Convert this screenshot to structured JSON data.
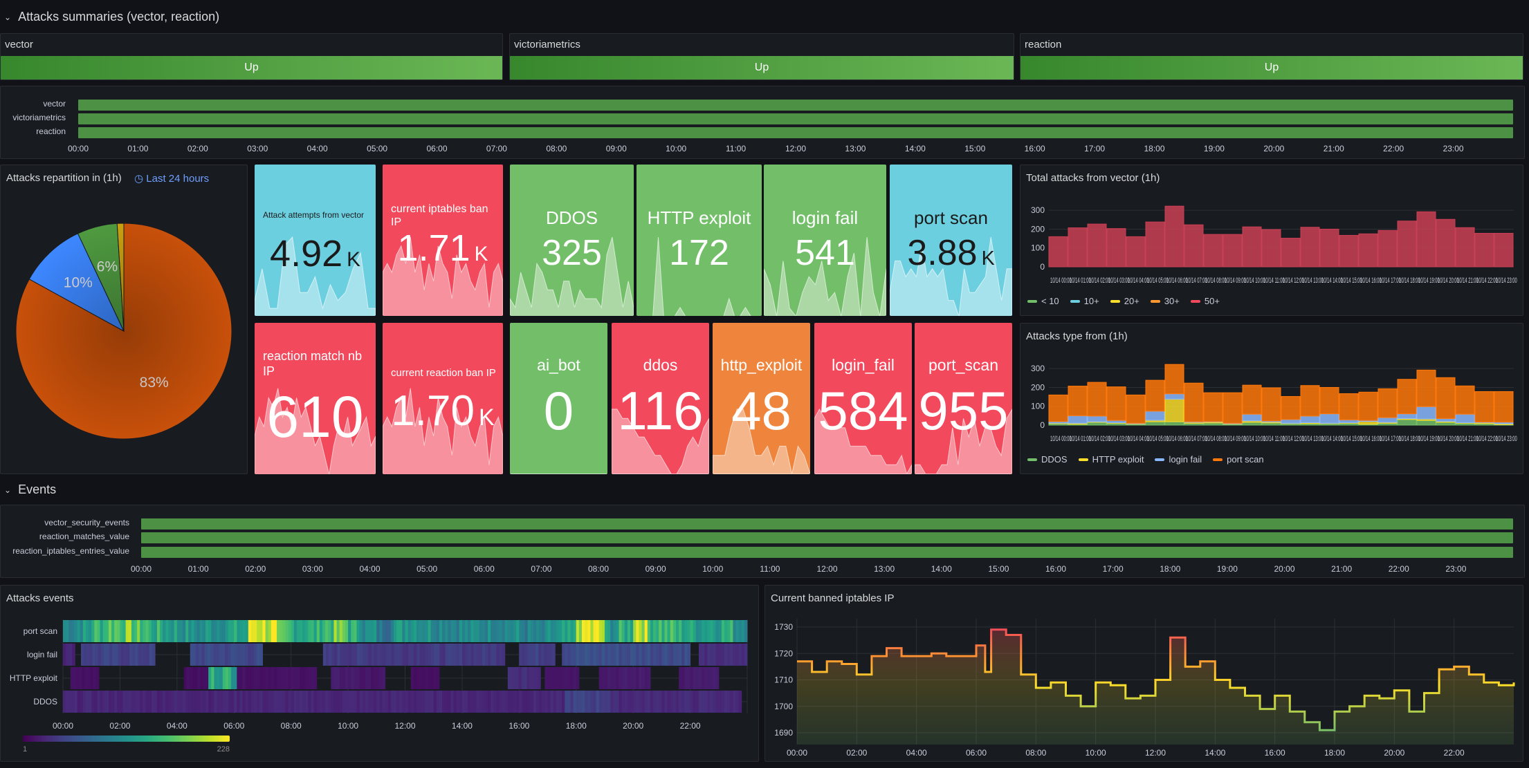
{
  "rows": {
    "summaries": "Attacks summaries (vector, reaction)",
    "events": "Events"
  },
  "status_panels": [
    {
      "name": "vector",
      "value": "Up"
    },
    {
      "name": "victoriametrics",
      "value": "Up"
    },
    {
      "name": "reaction",
      "value": "Up"
    }
  ],
  "colors": {
    "green": "#73bf69",
    "red": "#f2495c",
    "cyan": "#6ccfe0",
    "orange": "#ef843c",
    "up": "#56a64b"
  },
  "hours": [
    "00:00",
    "01:00",
    "02:00",
    "03:00",
    "04:00",
    "05:00",
    "06:00",
    "07:00",
    "08:00",
    "09:00",
    "10:00",
    "11:00",
    "12:00",
    "13:00",
    "14:00",
    "15:00",
    "16:00",
    "17:00",
    "18:00",
    "19:00",
    "20:00",
    "21:00",
    "22:00",
    "23:00"
  ],
  "status_timeline": {
    "series": [
      "vector",
      "victoriametrics",
      "reaction"
    ]
  },
  "events_timeline": {
    "series": [
      "vector_security_events",
      "reaction_matches_value",
      "reaction_iptables_entries_value"
    ]
  },
  "pie": {
    "title": "Attacks repartition in (1h)",
    "time_override": "Last 24 hours",
    "slices": [
      {
        "value": 83,
        "label": "83%",
        "color": "#c8500a"
      },
      {
        "value": 10,
        "label": "10%",
        "color": "#3d87ff"
      },
      {
        "value": 6,
        "label": "6%",
        "color": "#4f9a40"
      },
      {
        "value": 1,
        "label": "",
        "color": "#c8a010"
      }
    ]
  },
  "stats_row1": [
    {
      "title": "Attack attempts from vector",
      "value": "4.92",
      "unit": "K",
      "color": "#6ccfe0",
      "dark": true,
      "spark": [
        2,
        6,
        1,
        1,
        9,
        10,
        3,
        3,
        5,
        1,
        4,
        2,
        3,
        6,
        8,
        1,
        1
      ]
    },
    {
      "title": "current iptables ban IP",
      "value": "1.71",
      "unit": "K",
      "color": "#f2495c",
      "spark": [
        5,
        6,
        5,
        7,
        8,
        6,
        9,
        5,
        7,
        3,
        6,
        4,
        8,
        6,
        5,
        2,
        7,
        5,
        6,
        4,
        3,
        5,
        6,
        1,
        5,
        6,
        4
      ]
    },
    {
      "title": "DDOS",
      "value": "325",
      "unit": "",
      "color": "#73bf69",
      "spark": [
        2,
        1,
        5,
        3,
        1,
        6,
        5,
        3,
        3,
        1,
        4,
        4,
        1,
        3,
        2,
        2,
        2,
        1,
        7,
        9,
        5,
        1,
        4,
        1
      ]
    },
    {
      "title": "HTTP exploit",
      "value": "172",
      "unit": "",
      "color": "#73bf69",
      "spark": [
        0,
        0,
        0,
        0,
        9,
        0,
        0,
        0,
        1,
        0,
        0,
        0,
        0,
        0,
        0,
        0,
        0,
        2,
        0,
        0,
        1,
        0,
        0,
        0
      ]
    },
    {
      "title": "login fail",
      "value": "541",
      "unit": "",
      "color": "#73bf69",
      "spark": [
        6,
        4,
        0,
        7,
        1,
        0,
        3,
        5,
        4,
        7,
        2,
        3,
        0,
        5,
        8,
        0,
        10,
        3,
        0,
        6
      ]
    },
    {
      "title": "port scan",
      "value": "3.88",
      "unit": "K",
      "color": "#6ccfe0",
      "dark": true,
      "spark": [
        3,
        7,
        7,
        5,
        6,
        5,
        9,
        5,
        6,
        5,
        6,
        2,
        2,
        0,
        6,
        3,
        3,
        4,
        5,
        10,
        6,
        2,
        6,
        6
      ]
    }
  ],
  "stats_row2": [
    {
      "title": "reaction match nb IP",
      "value": "610",
      "unit": "",
      "color": "#f2495c",
      "spark": [
        4,
        6,
        5,
        8,
        7,
        9,
        6,
        7,
        5,
        8,
        6,
        7,
        5,
        3,
        4,
        2,
        0,
        3,
        5,
        4,
        6,
        3,
        4,
        5,
        6,
        3,
        4
      ]
    },
    {
      "title": "current reaction ban IP",
      "value": "1.70",
      "unit": "K",
      "color": "#f2495c",
      "spark": [
        5,
        6,
        5,
        7,
        8,
        6,
        9,
        5,
        7,
        3,
        6,
        4,
        8,
        6,
        5,
        2,
        7,
        5,
        6,
        4,
        3,
        5,
        6,
        1,
        5,
        6,
        4
      ]
    },
    {
      "title": "ai_bot",
      "value": "0",
      "unit": "",
      "color": "#73bf69",
      "spark": [
        0,
        0,
        0,
        0,
        0,
        0,
        0
      ]
    },
    {
      "title": "ddos",
      "value": "116",
      "unit": "",
      "color": "#f2495c",
      "spark": [
        7,
        7,
        6,
        6,
        5,
        4,
        4,
        3,
        2,
        2,
        1,
        0,
        0,
        1,
        3,
        4,
        3,
        5,
        6
      ]
    },
    {
      "title": "http_exploit",
      "value": "48",
      "unit": "",
      "color": "#ef843c",
      "spark": [
        2,
        2,
        2,
        5,
        7,
        7,
        5,
        2,
        2,
        3,
        1,
        3,
        3,
        0,
        3,
        2,
        0
      ]
    },
    {
      "title": "login_fail",
      "value": "584",
      "unit": "",
      "color": "#f2495c",
      "spark": [
        6,
        7,
        6,
        5,
        5,
        5,
        5,
        3,
        3,
        3,
        3,
        2,
        2,
        2,
        1,
        1,
        1,
        2,
        0,
        1
      ]
    },
    {
      "title": "port_scan",
      "value": "955",
      "unit": "",
      "color": "#f2495c",
      "spark": [
        1,
        1,
        0,
        0,
        0,
        1,
        1,
        5,
        1,
        6,
        4,
        6,
        3,
        5,
        5,
        3,
        2,
        6,
        7
      ]
    }
  ],
  "chart_data": [
    {
      "type": "bar",
      "title": "Total attacks from vector (1h)",
      "ylim": [
        0,
        330
      ],
      "yticks": [
        0,
        100,
        200,
        300
      ],
      "x": [
        "10/14 00:00",
        "10/14 01:00",
        "10/14 02:00",
        "10/14 03:00",
        "10/14 04:00",
        "10/14 05:00",
        "10/14 06:00",
        "10/14 07:00",
        "10/14 08:00",
        "10/14 09:00",
        "10/14 10:00",
        "10/14 11:00",
        "10/14 12:00",
        "10/14 13:00",
        "10/14 14:00",
        "10/14 15:00",
        "10/14 16:00",
        "10/14 17:00",
        "10/14 18:00",
        "10/14 19:00",
        "10/14 20:00",
        "10/14 21:00",
        "10/14 22:00",
        "10/14 23:00"
      ],
      "legend": [
        {
          "name": "< 10",
          "color": "#73bf69"
        },
        {
          "name": "10+",
          "color": "#6ccfe0"
        },
        {
          "name": "20+",
          "color": "#fade2a"
        },
        {
          "name": "30+",
          "color": "#ff9830"
        },
        {
          "name": "50+",
          "color": "#f2495c"
        }
      ],
      "series": [
        {
          "name": "50+",
          "color": "#c93f55",
          "values": [
            160,
            207,
            227,
            203,
            160,
            238,
            322,
            223,
            172,
            172,
            212,
            198,
            152,
            210,
            200,
            167,
            175,
            193,
            243,
            292,
            252,
            208,
            178,
            178
          ]
        }
      ]
    },
    {
      "type": "bar",
      "stacked": true,
      "title": "Attacks type from (1h)",
      "ylim": [
        0,
        330
      ],
      "yticks": [
        0,
        100,
        200,
        300
      ],
      "x": [
        "10/14 00:00",
        "10/14 01:00",
        "10/14 02:00",
        "10/14 03:00",
        "10/14 04:00",
        "10/14 05:00",
        "10/14 06:00",
        "10/14 07:00",
        "10/14 08:00",
        "10/14 09:00",
        "10/14 10:00",
        "10/14 11:00",
        "10/14 12:00",
        "10/14 13:00",
        "10/14 14:00",
        "10/14 15:00",
        "10/14 16:00",
        "10/14 17:00",
        "10/14 18:00",
        "10/14 19:00",
        "10/14 20:00",
        "10/14 21:00",
        "10/14 22:00",
        "10/14 23:00"
      ],
      "series": [
        {
          "name": "DDOS",
          "color": "#73bf69",
          "values": [
            8,
            5,
            15,
            10,
            5,
            18,
            18,
            10,
            12,
            5,
            15,
            12,
            8,
            8,
            8,
            10,
            5,
            10,
            30,
            25,
            15,
            10,
            8,
            3
          ]
        },
        {
          "name": "HTTP exploit",
          "color": "#fade2a",
          "values": [
            3,
            5,
            3,
            3,
            2,
            8,
            120,
            5,
            5,
            2,
            8,
            5,
            2,
            5,
            2,
            3,
            15,
            5,
            5,
            8,
            5,
            3,
            5,
            5
          ]
        },
        {
          "name": "login fail",
          "color": "#8ab8ff",
          "values": [
            8,
            40,
            30,
            12,
            3,
            48,
            28,
            3,
            2,
            3,
            35,
            5,
            20,
            35,
            50,
            15,
            5,
            25,
            25,
            65,
            15,
            45,
            3,
            8
          ]
        },
        {
          "name": "port scan",
          "color": "#ff780a",
          "values": [
            141,
            157,
            179,
            178,
            150,
            164,
            156,
            205,
            153,
            162,
            154,
            176,
            122,
            162,
            140,
            139,
            150,
            153,
            183,
            194,
            217,
            150,
            162,
            162
          ]
        }
      ]
    },
    {
      "type": "heatmap",
      "title": "Attacks events",
      "rows": [
        "port scan",
        "login fail",
        "HTTP exploit",
        "DDOS"
      ],
      "xticks": [
        "00:00",
        "02:00",
        "04:00",
        "06:00",
        "08:00",
        "10:00",
        "12:00",
        "14:00",
        "16:00",
        "18:00",
        "20:00",
        "22:00"
      ],
      "color_range": [
        1,
        228
      ],
      "color_min_label": "1",
      "color_max_label": "228",
      "port_scan_halfhourly": [
        110,
        120,
        150,
        170,
        175,
        160,
        140,
        130,
        120,
        110,
        120,
        125,
        130,
        225,
        215,
        150,
        145,
        140,
        160,
        170,
        140,
        110,
        90,
        120,
        130,
        120,
        115,
        110,
        105,
        110,
        115,
        110,
        100,
        95,
        110,
        120,
        215,
        205,
        120,
        140,
        220,
        160,
        150,
        140,
        130,
        135,
        140,
        120
      ],
      "segments": {
        "login fail": [
          [
            0,
            0.42,
            25
          ],
          [
            0.63,
            3.23,
            45
          ],
          [
            4.46,
            7.0,
            50
          ],
          [
            9.12,
            15.5,
            40
          ],
          [
            16.0,
            17.26,
            45
          ],
          [
            17.5,
            22.0,
            55
          ],
          [
            22.3,
            24,
            30
          ]
        ],
        "HTTP exploit": [
          [
            0.26,
            1.26,
            12
          ],
          [
            4.24,
            5.1,
            10
          ],
          [
            5.1,
            6.1,
            140
          ],
          [
            6.1,
            8.9,
            12
          ],
          [
            9.4,
            10.4,
            18
          ],
          [
            10.4,
            11.3,
            14
          ],
          [
            12.2,
            13.2,
            10
          ],
          [
            15.6,
            16.75,
            30
          ],
          [
            16.9,
            18.1,
            15
          ],
          [
            18.8,
            20.6,
            18
          ],
          [
            21.6,
            23.0,
            18
          ]
        ],
        "DDOS": [
          [
            0,
            17.6,
            25
          ],
          [
            17.6,
            19.2,
            45
          ],
          [
            19.2,
            23.8,
            28
          ]
        ]
      }
    },
    {
      "type": "line",
      "title": "Current banned iptables IP",
      "ylim": [
        1686,
        1733
      ],
      "yticks": [
        1690,
        1700,
        1710,
        1720,
        1730
      ],
      "xticks": [
        "00:00",
        "02:00",
        "04:00",
        "06:00",
        "08:00",
        "10:00",
        "12:00",
        "14:00",
        "16:00",
        "18:00",
        "20:00",
        "22:00"
      ],
      "x_hours": [
        0,
        0.5,
        1,
        1.5,
        2,
        2.5,
        3,
        3.5,
        4,
        4.5,
        5,
        5.5,
        6,
        6.3,
        6.5,
        7,
        7.3,
        7.5,
        8,
        8.5,
        9,
        9.5,
        10,
        10.5,
        11,
        11.5,
        12,
        12.5,
        13,
        13.5,
        14,
        14.5,
        15,
        15.5,
        16,
        16.5,
        17,
        17.5,
        18,
        18.5,
        19,
        19.5,
        20,
        20.5,
        21,
        21.5,
        22,
        22.5,
        23,
        23.5,
        24
      ],
      "values": [
        1717,
        1713,
        1717,
        1716,
        1712,
        1719,
        1722,
        1719,
        1719,
        1720,
        1719,
        1719,
        1723,
        1713,
        1729,
        1727,
        1727,
        1712,
        1707,
        1709,
        1704,
        1700,
        1709,
        1708,
        1703,
        1704,
        1710,
        1726,
        1715,
        1717,
        1710,
        1707,
        1704,
        1699,
        1704,
        1698,
        1694,
        1691,
        1698,
        1700,
        1704,
        1703,
        1706,
        1698,
        1705,
        1714,
        1715,
        1712,
        1709,
        1708,
        1709
      ]
    }
  ]
}
